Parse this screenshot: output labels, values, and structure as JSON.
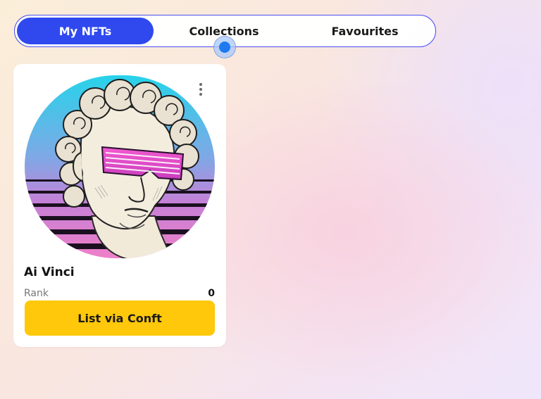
{
  "tabs": [
    {
      "label": "My NFTs",
      "active": true
    },
    {
      "label": "Collections",
      "active": false
    },
    {
      "label": "Favourites",
      "active": false
    }
  ],
  "nft_card": {
    "name": "Ai Vinci",
    "rank_label": "Rank",
    "rank_value": "0",
    "list_button_label": "List via Conft",
    "menu_icon": "more-vertical-icon",
    "image": "retro-statue-with-pink-shutter-shades"
  },
  "colors": {
    "tab_active": "#2f49ef",
    "tab_border": "#4a4df0",
    "list_button": "#ffc80a",
    "cursor_indicator": "#1f7af0"
  }
}
